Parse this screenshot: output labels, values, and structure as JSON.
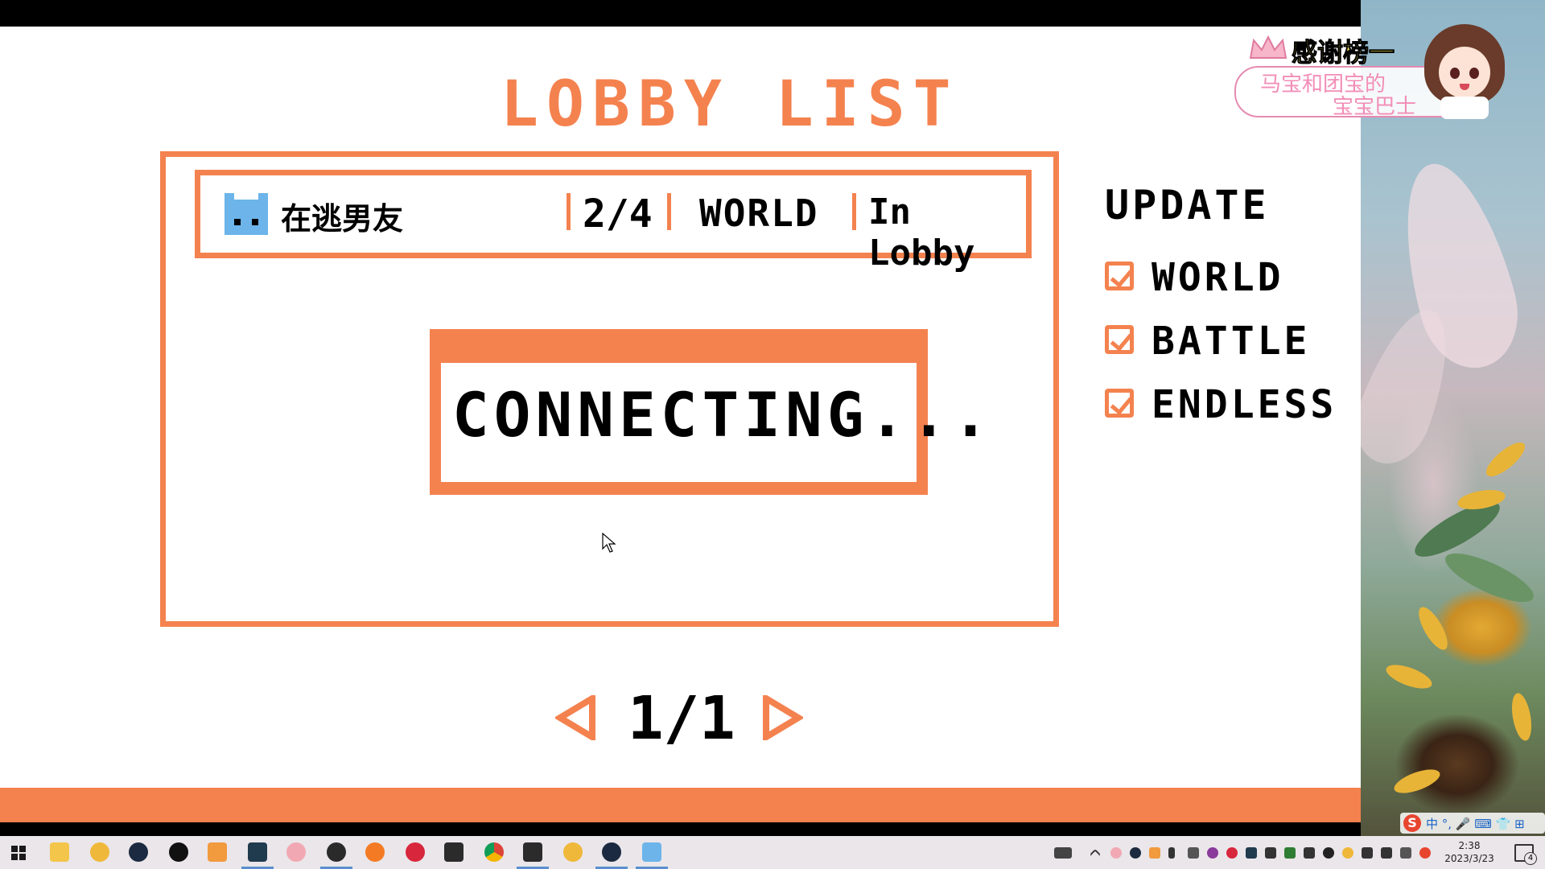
{
  "game": {
    "title": "LOBBY LIST",
    "lobbies": [
      {
        "name": "在逃男友",
        "players": "2/4",
        "mode": "WORLD",
        "status": "In Lobby"
      }
    ],
    "dialog_text": "CONNECTING...",
    "page_indicator": "1/1",
    "update_label": "UPDATE",
    "filters": [
      {
        "label": "WORLD",
        "checked": true
      },
      {
        "label": "BATTLE",
        "checked": true
      },
      {
        "label": "ENDLESS",
        "checked": true
      }
    ],
    "accent_color": "#f4824f"
  },
  "overlay": {
    "title": "感谢榜一",
    "line1": "马宝和团宝的",
    "line2": "宝宝巴士"
  },
  "ime": {
    "logo": "S",
    "text": "中 °, 🎤 ⌨ 👕 ⊞"
  },
  "clock": {
    "time": "2:38",
    "date": "2023/3/23"
  },
  "notification_count": "4"
}
